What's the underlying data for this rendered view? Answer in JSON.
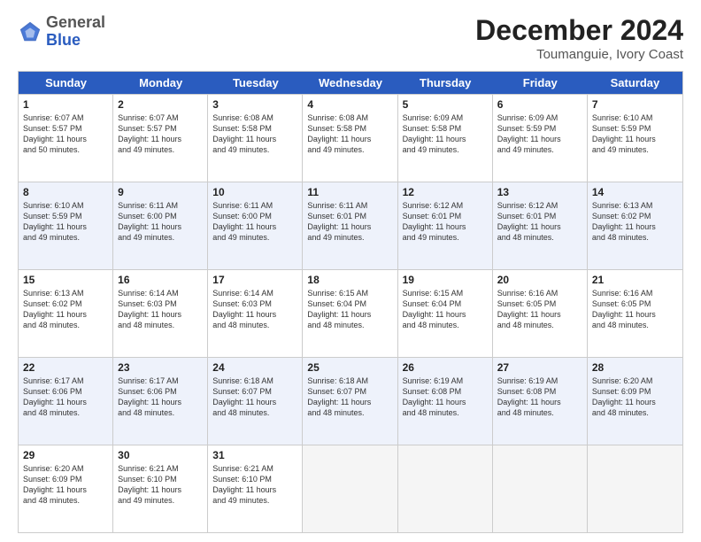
{
  "header": {
    "logo_general": "General",
    "logo_blue": "Blue",
    "month_year": "December 2024",
    "location": "Toumanguie, Ivory Coast"
  },
  "weekdays": [
    "Sunday",
    "Monday",
    "Tuesday",
    "Wednesday",
    "Thursday",
    "Friday",
    "Saturday"
  ],
  "rows": [
    {
      "alt": false,
      "cells": [
        {
          "day": "1",
          "info": "Sunrise: 6:07 AM\nSunset: 5:57 PM\nDaylight: 11 hours\nand 50 minutes."
        },
        {
          "day": "2",
          "info": "Sunrise: 6:07 AM\nSunset: 5:57 PM\nDaylight: 11 hours\nand 49 minutes."
        },
        {
          "day": "3",
          "info": "Sunrise: 6:08 AM\nSunset: 5:58 PM\nDaylight: 11 hours\nand 49 minutes."
        },
        {
          "day": "4",
          "info": "Sunrise: 6:08 AM\nSunset: 5:58 PM\nDaylight: 11 hours\nand 49 minutes."
        },
        {
          "day": "5",
          "info": "Sunrise: 6:09 AM\nSunset: 5:58 PM\nDaylight: 11 hours\nand 49 minutes."
        },
        {
          "day": "6",
          "info": "Sunrise: 6:09 AM\nSunset: 5:59 PM\nDaylight: 11 hours\nand 49 minutes."
        },
        {
          "day": "7",
          "info": "Sunrise: 6:10 AM\nSunset: 5:59 PM\nDaylight: 11 hours\nand 49 minutes."
        }
      ]
    },
    {
      "alt": true,
      "cells": [
        {
          "day": "8",
          "info": "Sunrise: 6:10 AM\nSunset: 5:59 PM\nDaylight: 11 hours\nand 49 minutes."
        },
        {
          "day": "9",
          "info": "Sunrise: 6:11 AM\nSunset: 6:00 PM\nDaylight: 11 hours\nand 49 minutes."
        },
        {
          "day": "10",
          "info": "Sunrise: 6:11 AM\nSunset: 6:00 PM\nDaylight: 11 hours\nand 49 minutes."
        },
        {
          "day": "11",
          "info": "Sunrise: 6:11 AM\nSunset: 6:01 PM\nDaylight: 11 hours\nand 49 minutes."
        },
        {
          "day": "12",
          "info": "Sunrise: 6:12 AM\nSunset: 6:01 PM\nDaylight: 11 hours\nand 49 minutes."
        },
        {
          "day": "13",
          "info": "Sunrise: 6:12 AM\nSunset: 6:01 PM\nDaylight: 11 hours\nand 48 minutes."
        },
        {
          "day": "14",
          "info": "Sunrise: 6:13 AM\nSunset: 6:02 PM\nDaylight: 11 hours\nand 48 minutes."
        }
      ]
    },
    {
      "alt": false,
      "cells": [
        {
          "day": "15",
          "info": "Sunrise: 6:13 AM\nSunset: 6:02 PM\nDaylight: 11 hours\nand 48 minutes."
        },
        {
          "day": "16",
          "info": "Sunrise: 6:14 AM\nSunset: 6:03 PM\nDaylight: 11 hours\nand 48 minutes."
        },
        {
          "day": "17",
          "info": "Sunrise: 6:14 AM\nSunset: 6:03 PM\nDaylight: 11 hours\nand 48 minutes."
        },
        {
          "day": "18",
          "info": "Sunrise: 6:15 AM\nSunset: 6:04 PM\nDaylight: 11 hours\nand 48 minutes."
        },
        {
          "day": "19",
          "info": "Sunrise: 6:15 AM\nSunset: 6:04 PM\nDaylight: 11 hours\nand 48 minutes."
        },
        {
          "day": "20",
          "info": "Sunrise: 6:16 AM\nSunset: 6:05 PM\nDaylight: 11 hours\nand 48 minutes."
        },
        {
          "day": "21",
          "info": "Sunrise: 6:16 AM\nSunset: 6:05 PM\nDaylight: 11 hours\nand 48 minutes."
        }
      ]
    },
    {
      "alt": true,
      "cells": [
        {
          "day": "22",
          "info": "Sunrise: 6:17 AM\nSunset: 6:06 PM\nDaylight: 11 hours\nand 48 minutes."
        },
        {
          "day": "23",
          "info": "Sunrise: 6:17 AM\nSunset: 6:06 PM\nDaylight: 11 hours\nand 48 minutes."
        },
        {
          "day": "24",
          "info": "Sunrise: 6:18 AM\nSunset: 6:07 PM\nDaylight: 11 hours\nand 48 minutes."
        },
        {
          "day": "25",
          "info": "Sunrise: 6:18 AM\nSunset: 6:07 PM\nDaylight: 11 hours\nand 48 minutes."
        },
        {
          "day": "26",
          "info": "Sunrise: 6:19 AM\nSunset: 6:08 PM\nDaylight: 11 hours\nand 48 minutes."
        },
        {
          "day": "27",
          "info": "Sunrise: 6:19 AM\nSunset: 6:08 PM\nDaylight: 11 hours\nand 48 minutes."
        },
        {
          "day": "28",
          "info": "Sunrise: 6:20 AM\nSunset: 6:09 PM\nDaylight: 11 hours\nand 48 minutes."
        }
      ]
    },
    {
      "alt": false,
      "cells": [
        {
          "day": "29",
          "info": "Sunrise: 6:20 AM\nSunset: 6:09 PM\nDaylight: 11 hours\nand 48 minutes."
        },
        {
          "day": "30",
          "info": "Sunrise: 6:21 AM\nSunset: 6:10 PM\nDaylight: 11 hours\nand 49 minutes."
        },
        {
          "day": "31",
          "info": "Sunrise: 6:21 AM\nSunset: 6:10 PM\nDaylight: 11 hours\nand 49 minutes."
        },
        {
          "day": "",
          "info": ""
        },
        {
          "day": "",
          "info": ""
        },
        {
          "day": "",
          "info": ""
        },
        {
          "day": "",
          "info": ""
        }
      ]
    }
  ]
}
